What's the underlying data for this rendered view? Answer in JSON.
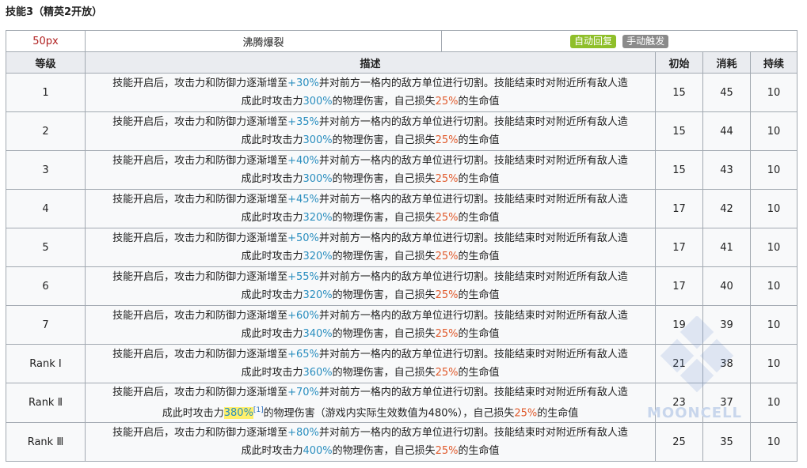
{
  "heading": "技能3（精英2开放）",
  "skill": {
    "icon_label": "50px",
    "name": "沸腾爆裂",
    "recovery_badge": "自动回复",
    "trigger_badge": "手动触发"
  },
  "columns": [
    "等级",
    "描述",
    "初始",
    "消耗",
    "持续"
  ],
  "rows": [
    {
      "level": "1",
      "p1": "技能开启后，攻击力和防御力逐渐增至",
      "v1": "+30%",
      "p2": "并对前方一格内的敌方单位进行切割。技能结束时对附近所有敌人造",
      "p3": "成此时攻击力",
      "v2": "300%",
      "p4": "的物理伤害，自己损失",
      "v3": "25%",
      "p5": "的生命值",
      "init": "15",
      "cost": "45",
      "dur": "10"
    },
    {
      "level": "2",
      "p1": "技能开启后，攻击力和防御力逐渐增至",
      "v1": "+35%",
      "p2": "并对前方一格内的敌方单位进行切割。技能结束时对附近所有敌人造",
      "p3": "成此时攻击力",
      "v2": "300%",
      "p4": "的物理伤害，自己损失",
      "v3": "25%",
      "p5": "的生命值",
      "init": "15",
      "cost": "44",
      "dur": "10"
    },
    {
      "level": "3",
      "p1": "技能开启后，攻击力和防御力逐渐增至",
      "v1": "+40%",
      "p2": "并对前方一格内的敌方单位进行切割。技能结束时对附近所有敌人造",
      "p3": "成此时攻击力",
      "v2": "300%",
      "p4": "的物理伤害，自己损失",
      "v3": "25%",
      "p5": "的生命值",
      "init": "15",
      "cost": "43",
      "dur": "10"
    },
    {
      "level": "4",
      "p1": "技能开启后，攻击力和防御力逐渐增至",
      "v1": "+45%",
      "p2": "并对前方一格内的敌方单位进行切割。技能结束时对附近所有敌人造",
      "p3": "成此时攻击力",
      "v2": "320%",
      "p4": "的物理伤害，自己损失",
      "v3": "25%",
      "p5": "的生命值",
      "init": "17",
      "cost": "42",
      "dur": "10"
    },
    {
      "level": "5",
      "p1": "技能开启后，攻击力和防御力逐渐增至",
      "v1": "+50%",
      "p2": "并对前方一格内的敌方单位进行切割。技能结束时对附近所有敌人造",
      "p3": "成此时攻击力",
      "v2": "320%",
      "p4": "的物理伤害，自己损失",
      "v3": "25%",
      "p5": "的生命值",
      "init": "17",
      "cost": "41",
      "dur": "10"
    },
    {
      "level": "6",
      "p1": "技能开启后，攻击力和防御力逐渐增至",
      "v1": "+55%",
      "p2": "并对前方一格内的敌方单位进行切割。技能结束时对附近所有敌人造",
      "p3": "成此时攻击力",
      "v2": "320%",
      "p4": "的物理伤害，自己损失",
      "v3": "25%",
      "p5": "的生命值",
      "init": "17",
      "cost": "40",
      "dur": "10"
    },
    {
      "level": "7",
      "p1": "技能开启后，攻击力和防御力逐渐增至",
      "v1": "+60%",
      "p2": "并对前方一格内的敌方单位进行切割。技能结束时对附近所有敌人造",
      "p3": "成此时攻击力",
      "v2": "340%",
      "p4": "的物理伤害，自己损失",
      "v3": "25%",
      "p5": "的生命值",
      "init": "19",
      "cost": "39",
      "dur": "10"
    },
    {
      "level": "Rank Ⅰ",
      "p1": "技能开启后，攻击力和防御力逐渐增至",
      "v1": "+65%",
      "p2": "并对前方一格内的敌方单位进行切割。技能结束时对附近所有敌人造",
      "p3": "成此时攻击力",
      "v2": "360%",
      "p4": "的物理伤害，自己损失",
      "v3": "25%",
      "p5": "的生命值",
      "init": "21",
      "cost": "38",
      "dur": "10"
    },
    {
      "level": "Rank Ⅱ",
      "p1": "技能开启后，攻击力和防御力逐渐增至",
      "v1": "+70%",
      "p2": "并对前方一格内的敌方单位进行切割。技能结束时对附近所有敌人造",
      "p3": "成此时攻击力",
      "v2": "380%",
      "sup": "[1]",
      "p4": "的物理伤害（游戏内实际生效数值为480%），自己损失",
      "v3": "25%",
      "p5": "的生命值",
      "init": "23",
      "cost": "37",
      "dur": "10"
    },
    {
      "level": "Rank Ⅲ",
      "p1": "技能开启后，攻击力和防御力逐渐增至",
      "v1": "+80%",
      "p2": "并对前方一格内的敌方单位进行切割。技能结束时对附近所有敌人造",
      "p3": "成此时攻击力",
      "v2": "400%",
      "p4": "的物理伤害，自己损失",
      "v3": "25%",
      "p5": "的生命值",
      "init": "25",
      "cost": "35",
      "dur": "10"
    }
  ],
  "watermark": "MOONCELL"
}
